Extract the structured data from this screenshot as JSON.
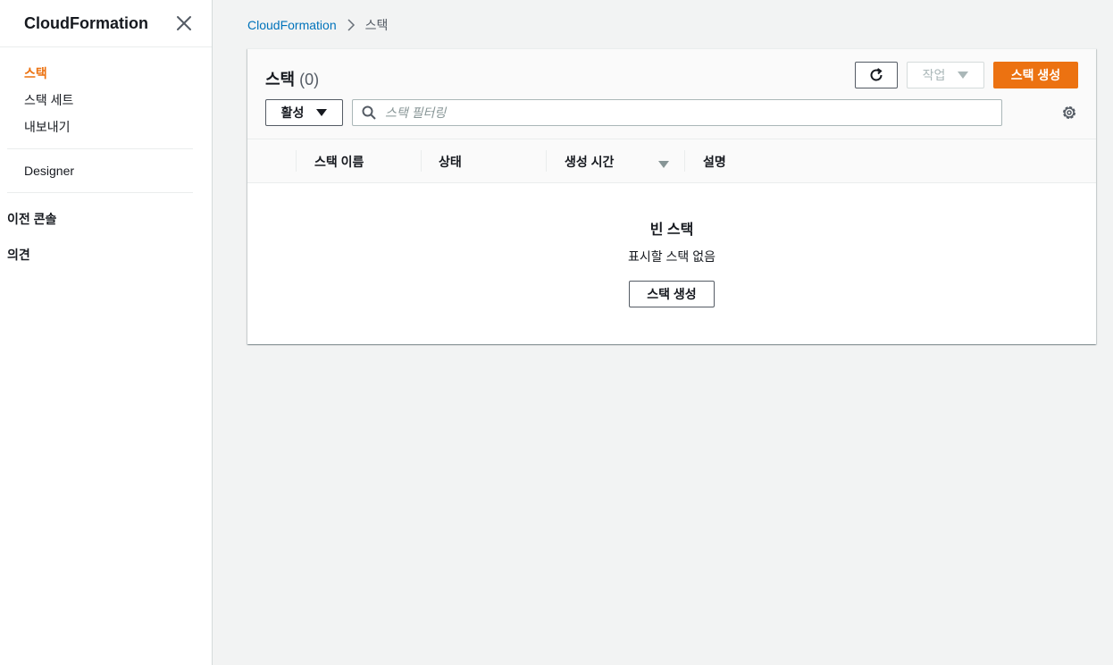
{
  "sidebar": {
    "title": "CloudFormation",
    "items": [
      {
        "label": "스택",
        "active": true
      },
      {
        "label": "스택 세트"
      },
      {
        "label": "내보내기"
      }
    ],
    "designer": "Designer",
    "previous_console": "이전 콘솔",
    "feedback": "의견"
  },
  "breadcrumb": {
    "root": "CloudFormation",
    "current": "스택"
  },
  "panel": {
    "title": "스택",
    "count": "(0)",
    "actions_label": "작업",
    "create_label": "스택 생성",
    "status_filter": "활성",
    "search_placeholder": "스택 필터링"
  },
  "table": {
    "columns": [
      "스택 이름",
      "상태",
      "생성 시간",
      "설명"
    ]
  },
  "empty_state": {
    "title": "빈 스택",
    "description": "표시할 스택 없음",
    "button": "스택 생성"
  },
  "colors": {
    "accent": "#ec7211",
    "link": "#0073bb"
  }
}
